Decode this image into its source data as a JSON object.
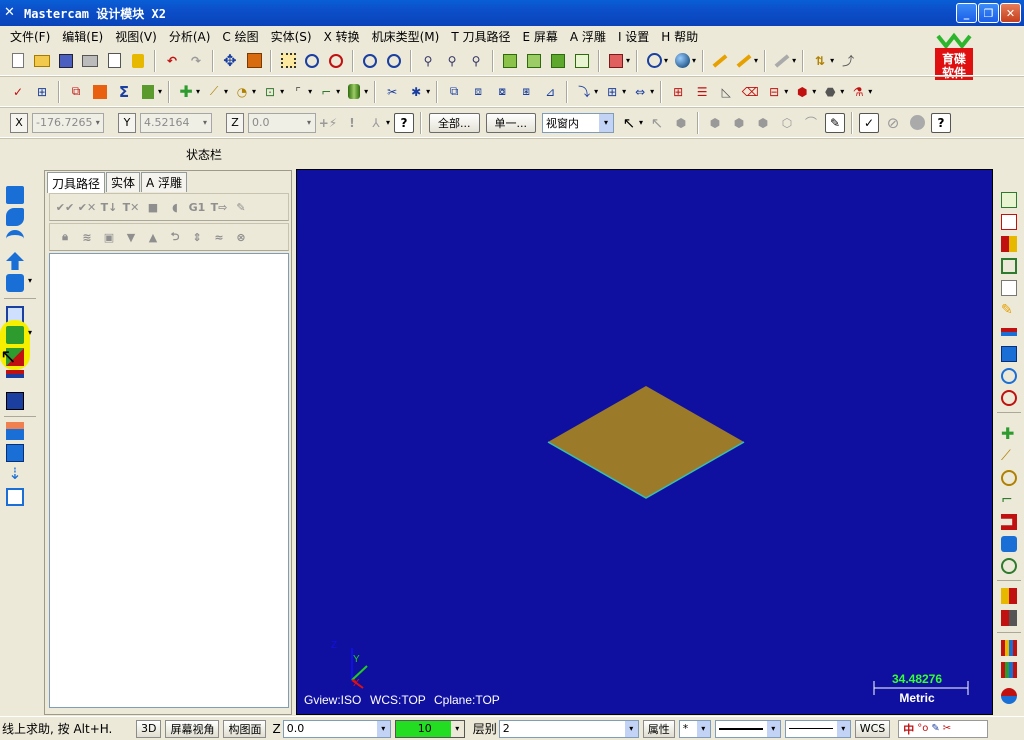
{
  "window": {
    "title": "Mastercam 设计模块  X2",
    "minimize_label": "_",
    "maximize_label": "❐",
    "close_label": "✕"
  },
  "menu": [
    "文件(F)",
    "编辑(E)",
    "视图(V)",
    "分析(A)",
    "C 绘图",
    "实体(S)",
    "X 转换",
    "机床类型(M)",
    "T 刀具路径",
    "E 屏幕",
    "A 浮雕",
    "I 设置",
    "H 帮助"
  ],
  "coords": {
    "x_label": "X",
    "x_value": "-176.7265",
    "y_label": "Y",
    "y_value": "4.52164",
    "z_label": "Z",
    "z_value": "0.0",
    "all_button": "全部...",
    "single_button": "单一...",
    "window_mode": "视窗内"
  },
  "status_label": "状态栏",
  "ops_panel": {
    "tabs": [
      "刀具路径",
      "实体",
      "A 浮雕"
    ],
    "active_tab": 0
  },
  "viewport": {
    "background": "#1010a0",
    "part_color": "#9b7a2a",
    "gview": "Gview:ISO",
    "wcs": "WCS:TOP",
    "cplane": "Cplane:TOP",
    "axis_y_label": "Y",
    "axis_x_label": "X",
    "axis_z_label": "Z",
    "scale_value": "34.48276",
    "scale_unit": "Metric"
  },
  "bottom": {
    "help_text": "线上求助, 按 Alt+H.",
    "btn_3d": "3D",
    "screen_view": "屏幕视角",
    "construction_plane": "构图面",
    "z_label": "Z",
    "z_value": "0.0",
    "color_value": "10",
    "layer_label": "层别",
    "layer_value": "2",
    "attributes": "属性",
    "point_style": "*",
    "wcs_btn": "WCS"
  },
  "logo_text": "育碟软件"
}
